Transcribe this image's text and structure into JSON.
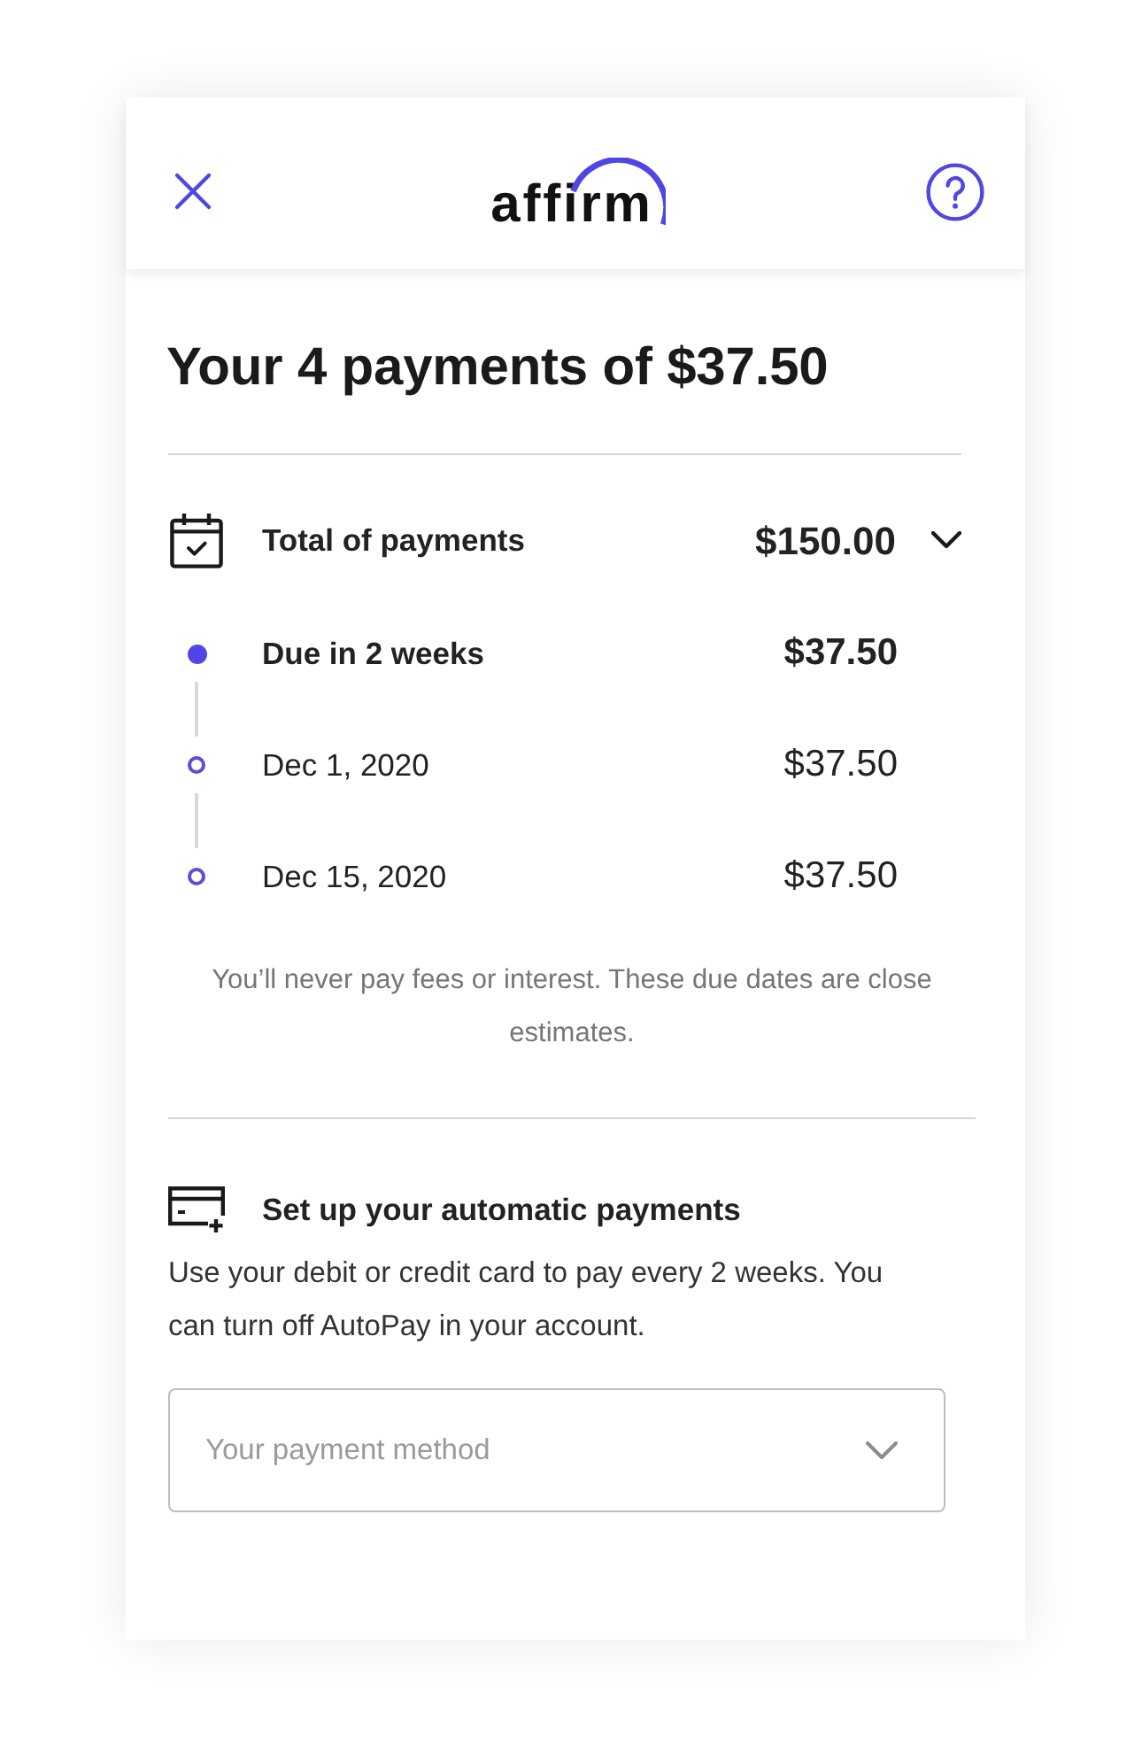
{
  "header": {
    "logo": "affirm"
  },
  "title": "Your 4 payments of $37.50",
  "total": {
    "label": "Total of payments",
    "amount": "$150.00",
    "expanded": true
  },
  "schedule": [
    {
      "label": "Due in 2 weeks",
      "amount": "$37.50",
      "current": true
    },
    {
      "label": "Dec 1, 2020",
      "amount": "$37.50",
      "current": false
    },
    {
      "label": "Dec 15, 2020",
      "amount": "$37.50",
      "current": false
    }
  ],
  "note": "You’ll never pay fees or interest. These due dates are close estimates.",
  "autopay": {
    "heading": "Set up your automatic payments",
    "description": "Use your debit or credit card to pay every 2 weeks. You can turn off AutoPay in your account.",
    "payment_method": {
      "placeholder": "Your payment method"
    }
  }
}
